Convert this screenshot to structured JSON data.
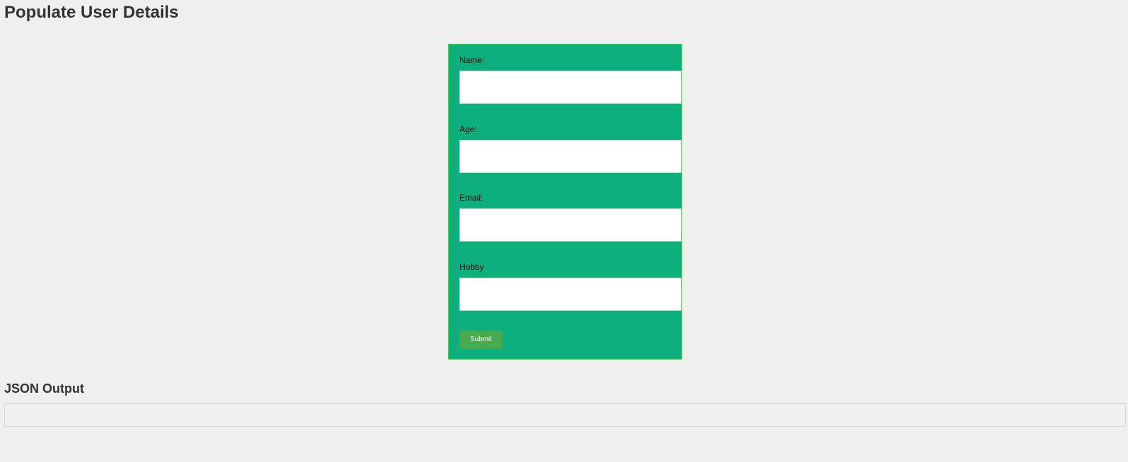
{
  "page": {
    "title": "Populate User Details"
  },
  "form": {
    "fields": [
      {
        "label": "Name:",
        "value": ""
      },
      {
        "label": "Age:",
        "value": ""
      },
      {
        "label": "Email:",
        "value": ""
      },
      {
        "label": "Hobby",
        "value": ""
      }
    ],
    "submit_label": "Submit"
  },
  "output": {
    "title": "JSON Output",
    "content": ""
  },
  "colors": {
    "page_background": "#efefef",
    "form_background": "#0db07c",
    "form_border": "#39e02a",
    "submit_button": "#46aa4f",
    "heading_text": "#333333"
  }
}
